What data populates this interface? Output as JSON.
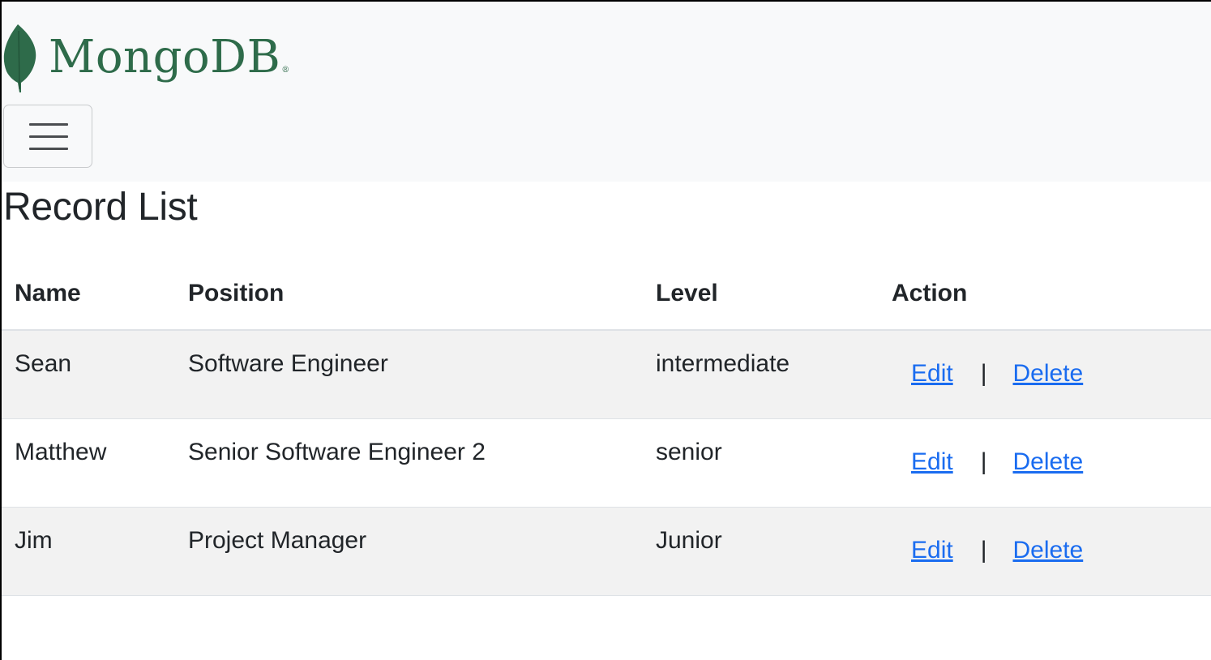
{
  "navbar": {
    "brand": "MongoDB",
    "brand_reg": "®",
    "toggler_icon": "hamburger-menu-icon",
    "leaf_icon": "mongodb-leaf-icon",
    "leaf_color": "#2e6b4a"
  },
  "page": {
    "title": "Record List"
  },
  "table": {
    "headers": [
      "Name",
      "Position",
      "Level",
      "Action"
    ],
    "rows": [
      {
        "name": "Sean",
        "position": "Software Engineer",
        "level": "intermediate",
        "edit": "Edit",
        "sep": "|",
        "delete": "Delete"
      },
      {
        "name": "Matthew",
        "position": "Senior Software Engineer 2",
        "level": "senior",
        "edit": "Edit",
        "sep": "|",
        "delete": "Delete"
      },
      {
        "name": "Jim",
        "position": "Project Manager",
        "level": "Junior",
        "edit": "Edit",
        "sep": "|",
        "delete": "Delete"
      }
    ]
  },
  "colors": {
    "link": "#1a6cf0",
    "stripe": "#f2f2f2",
    "navbar_bg": "#f8f9fa"
  }
}
